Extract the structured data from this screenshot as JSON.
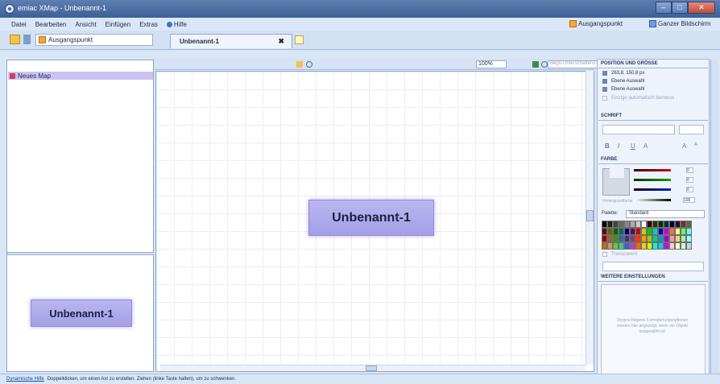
{
  "window": {
    "title": "emiac XMap - Unbenannt-1",
    "minimize": "–",
    "maximize": "□",
    "close": "✕"
  },
  "menu": {
    "items": [
      "Datei",
      "Bearbeiten",
      "Ansicht",
      "Einfügen",
      "Extras"
    ],
    "help": "Hilfe",
    "right_items": [
      "Ausgangspunkt",
      "Ganzer Bildschirm"
    ]
  },
  "tabrow": {
    "map_select": "Ausgangspunkt",
    "doc_tab": "Unbenannt-1",
    "doc_tab_close": "✖"
  },
  "left_panel": {
    "tree_item": "Neues Map",
    "preview_topic": "Unbenannt-1"
  },
  "canvas": {
    "zoom": "100%",
    "search_placeholder": "Begri-Unterschaftens+Fördern",
    "main_topic": "Unbenannt-1"
  },
  "right_panel": {
    "section_position": "POSITION UND GRÖSSE",
    "position_value": "263,8, 150,8 px",
    "line_level_1": "Ebene Auswahl",
    "line_level_2": "Ebene Auswahl",
    "line_dim": "Einzige automatisch bemesst",
    "section_font": "SCHRIFT",
    "fmt_buttons": [
      "B",
      "I",
      "U",
      "A"
    ],
    "fmt_right": [
      "A",
      "A"
    ],
    "section_color": "FARBE",
    "color_values": [
      "0",
      "0",
      "0"
    ],
    "alpha_value": "100",
    "alpha_label": "Hintergrundfarbe",
    "palette_label": "Palette:",
    "palette_value": "Standard",
    "transparent_label": "Transparent",
    "section_more": "WEITERE EINSTELLUNGEN",
    "note": "Vorgeschlagene Formatierungsoptionen werden hier angezeigt, wenn ein Objekt ausgewählt ist."
  },
  "status": {
    "link": "Dynamische Hilfe",
    "text": "Doppelklicken, um einen Ast zu erstellen. Ziehen (linke Taste halten), um zu schwenken."
  },
  "colors": {
    "title_bar": "#3d5f95",
    "topic_fill": "#a49fe6",
    "tree_highlight": "#c9c2f2",
    "accent_orange": "#f4a73b"
  }
}
